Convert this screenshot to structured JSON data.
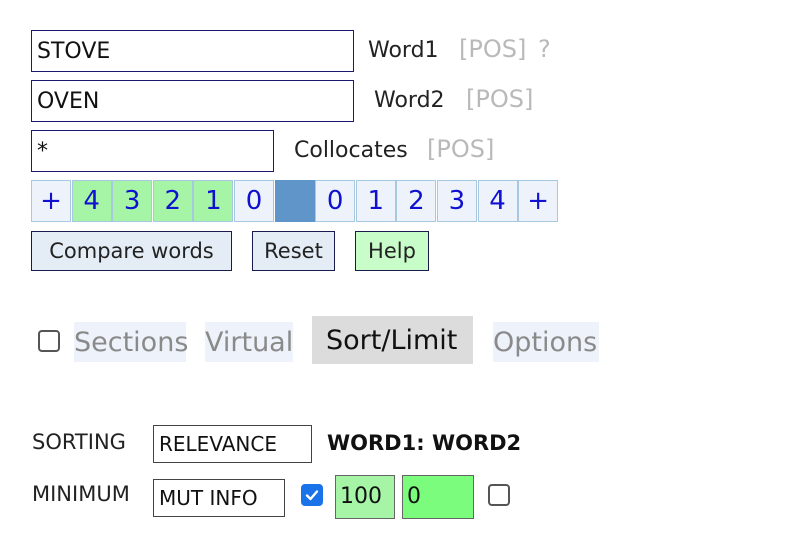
{
  "word1": {
    "value": "STOVE",
    "label": "Word1",
    "pos": "[POS]",
    "help": "?"
  },
  "word2": {
    "value": "OVEN",
    "label": "Word2",
    "pos": "[POS]"
  },
  "collocates": {
    "value": "*",
    "label": "Collocates",
    "pos": "[POS]"
  },
  "window": {
    "left_plus": "+",
    "left": [
      "4",
      "3",
      "2",
      "1",
      "0"
    ],
    "right": [
      "0",
      "1",
      "2",
      "3",
      "4"
    ],
    "right_plus": "+"
  },
  "buttons": {
    "compare": "Compare words",
    "reset": "Reset",
    "help": "Help"
  },
  "tabs": {
    "sections": "Sections",
    "virtual": "Virtual",
    "sort_limit": "Sort/Limit",
    "options": "Options"
  },
  "sorting": {
    "label": "SORTING",
    "value": "RELEVANCE",
    "order": "WORD1: WORD2"
  },
  "minimum": {
    "label": "MINIMUM",
    "value": "MUT INFO",
    "freq": "100",
    "mi": "0"
  },
  "colors": {
    "accent_green": "#a6f5a6",
    "node_blue": "#5f95c8",
    "link_blue": "#1010d0"
  }
}
